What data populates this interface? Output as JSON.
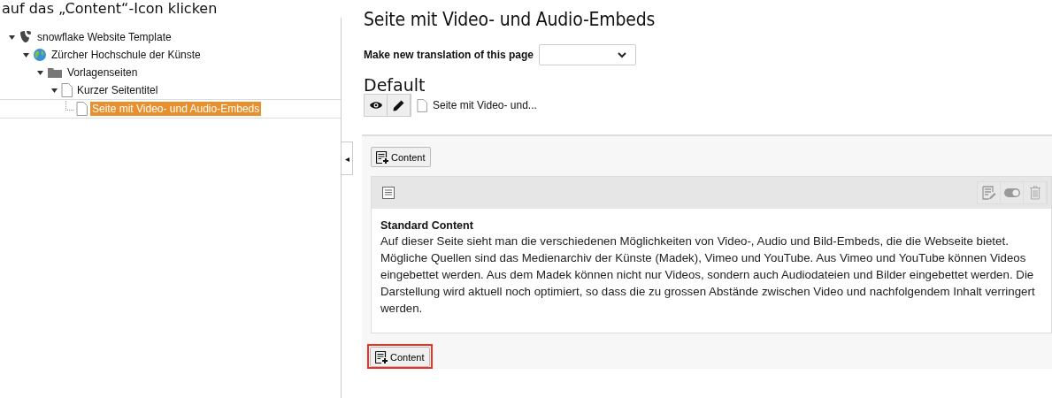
{
  "caption": "auf das „Content“-Icon klicken",
  "page_tree": {
    "items": [
      {
        "label": "snowflake Website Template",
        "kind": "root",
        "selected": false,
        "expanded": true,
        "children": [
          {
            "label": "Zürcher Hochschule der Künste",
            "kind": "globe",
            "selected": false,
            "expanded": true,
            "children": [
              {
                "label": "Vorlagenseiten",
                "kind": "folder",
                "selected": false,
                "expanded": true,
                "children": [
                  {
                    "label": "Kurzer Seitentitel",
                    "kind": "page",
                    "selected": false,
                    "expanded": true,
                    "children": [
                      {
                        "label": "Seite mit Video- und Audio-Embeds",
                        "kind": "page",
                        "selected": true
                      }
                    ]
                  }
                ]
              }
            ]
          }
        ]
      }
    ]
  },
  "collapse_toggle": "◂",
  "page_title": "Seite mit Video- und Audio-Embeds",
  "translation": {
    "label": "Make new translation of this page"
  },
  "language": {
    "heading": "Default",
    "page_label": "Seite mit Video- und..."
  },
  "content_area": {
    "new_content_buttons": [
      {
        "label": "Content",
        "highlighted": false
      },
      {
        "label": "Content",
        "highlighted": true
      }
    ],
    "element": {
      "title": "Standard Content",
      "text": "Auf dieser Seite sieht man die verschiedenen Möglichkeiten von Video-, Audio und Bild-Embeds, die die Webseite bietet. Mögliche Quellen sind das Medienarchiv der Künste (Madek), Vimeo und YouTube. Aus Vimeo und YouTube können Videos eingebettet werden. Aus dem Madek können nicht nur Videos, sondern auch Audiodateien und Bilder eingebettet werden. Die Darstellung wird aktuell noch optimiert, so dass die zu grossen Abstände zwischen Video und nachfolgendem Inhalt verringert werden."
    }
  }
}
